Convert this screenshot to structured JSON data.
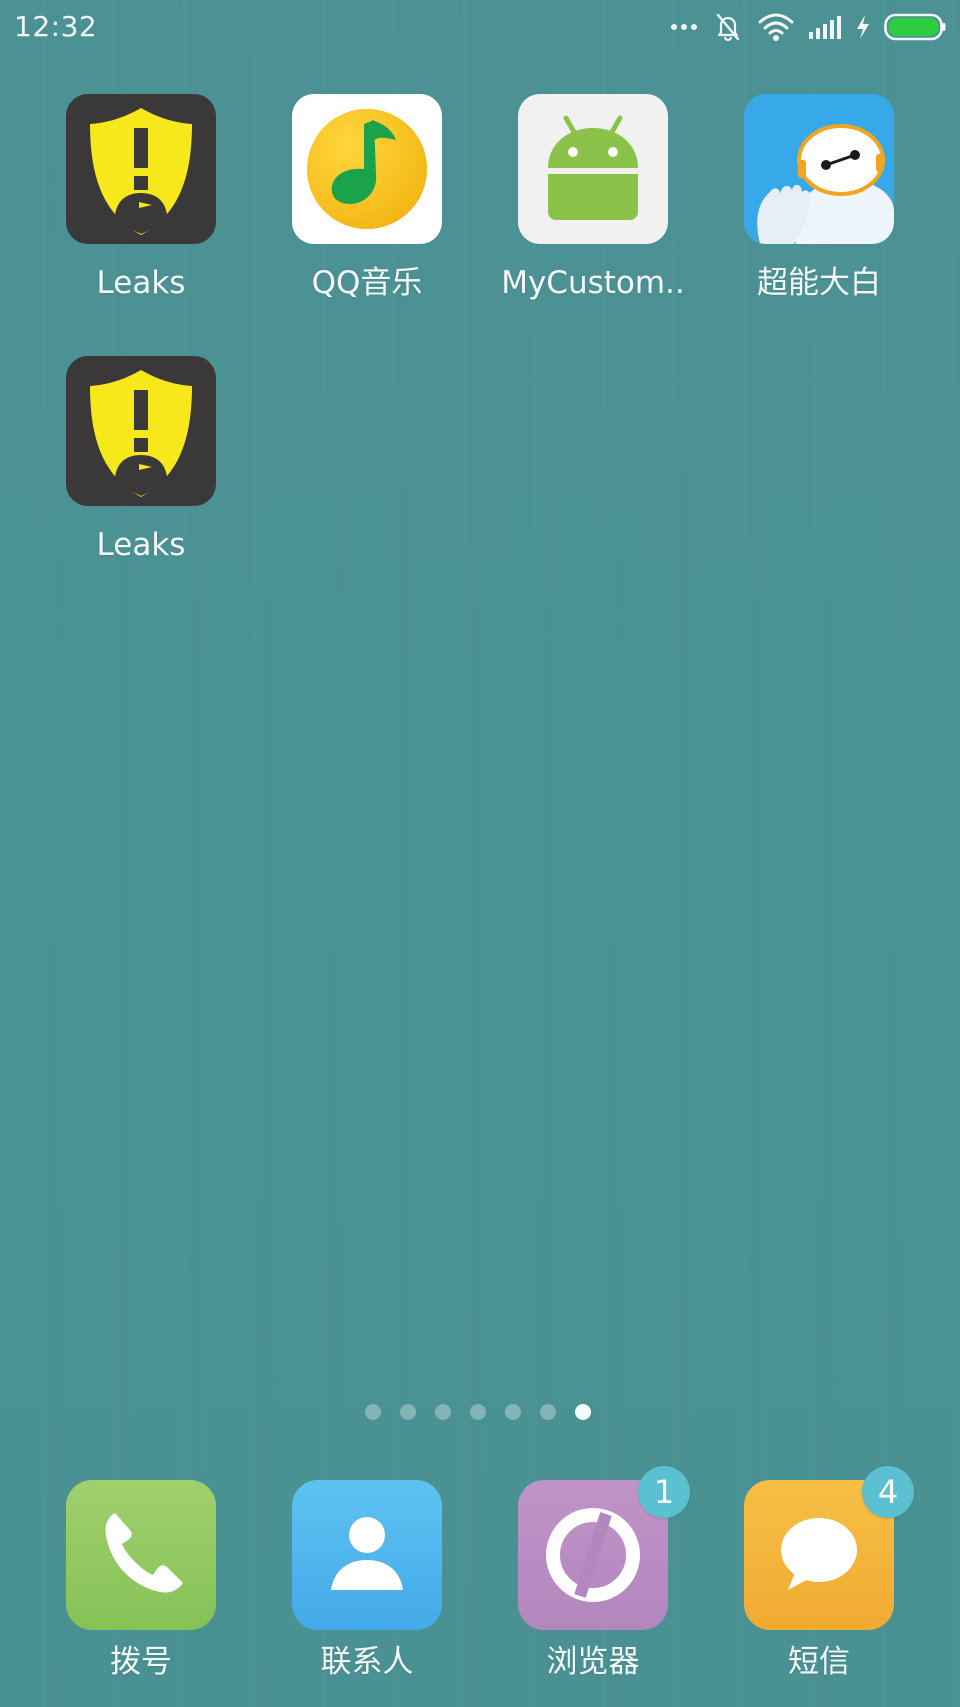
{
  "status_bar": {
    "time": "12:32",
    "icons": [
      "more-dots-icon",
      "vibrate-off-icon",
      "wifi-icon",
      "signal-icon",
      "charging-bolt-icon",
      "battery-icon"
    ],
    "battery_color": "#2ecc40"
  },
  "apps": [
    {
      "label": "Leaks",
      "icon": "leaks-shield-icon"
    },
    {
      "label": "QQ音乐",
      "icon": "qq-music-icon"
    },
    {
      "label": "MyCustom..",
      "icon": "android-robot-icon"
    },
    {
      "label": "超能大白",
      "icon": "baymax-icon"
    },
    {
      "label": "Leaks",
      "icon": "leaks-shield-icon"
    }
  ],
  "page_indicator": {
    "total": 7,
    "active_index": 6
  },
  "dock": [
    {
      "label": "拨号",
      "icon": "phone-icon",
      "color": "#8dc35b"
    },
    {
      "label": "联系人",
      "icon": "contacts-icon",
      "color": "#4fb6ec"
    },
    {
      "label": "浏览器",
      "icon": "browser-icon",
      "color": "#b98bc1",
      "badge": "1"
    },
    {
      "label": "短信",
      "icon": "message-bubble-icon",
      "color": "#f3b53b",
      "badge": "4"
    }
  ],
  "colors": {
    "wallpaper": "#4b9294",
    "badge": "#5bc0d2"
  }
}
